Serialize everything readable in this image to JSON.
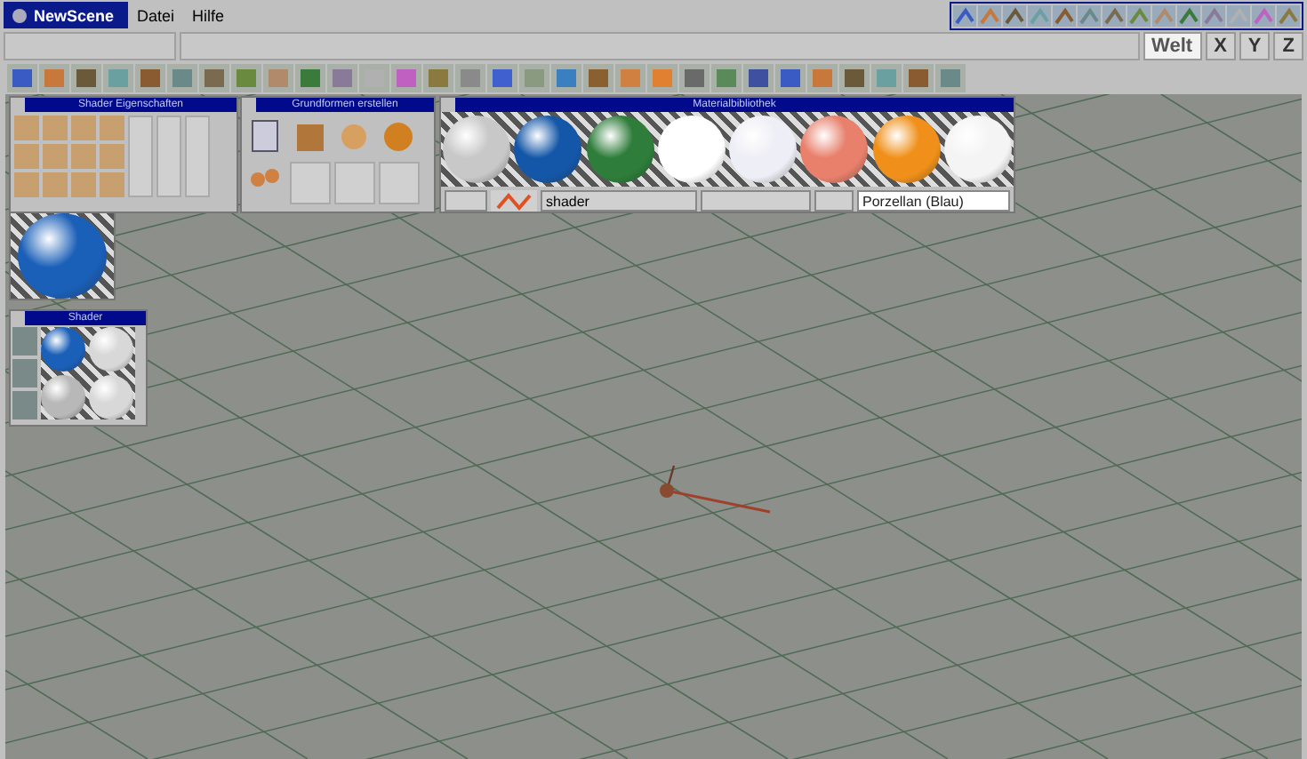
{
  "window": {
    "title": "NewScene"
  },
  "menu": [
    "Datei",
    "Hilfe"
  ],
  "coord_buttons": [
    {
      "label": "Welt",
      "selected": true
    },
    {
      "label": "X",
      "selected": false
    },
    {
      "label": "Y",
      "selected": false
    },
    {
      "label": "Z",
      "selected": false
    }
  ],
  "shader_properties": {
    "title": "Shader Eigenschaften"
  },
  "primitives": {
    "title": "Grundformen erstellen"
  },
  "preview": {
    "color": "#1a5fb8"
  },
  "library": {
    "title": "Materialbibliothek",
    "materials": [
      {
        "color": "#c8c8c8"
      },
      {
        "color": "#1457a8"
      },
      {
        "color": "#2e7d3a"
      },
      {
        "color": "#ffffff"
      },
      {
        "color": "#eeeef6"
      },
      {
        "color": "#e8806c"
      },
      {
        "color": "#f0901a"
      },
      {
        "color": "#f4f4f4"
      }
    ],
    "type_dropdown": "shader",
    "material_name": "Porzellan (Blau)"
  },
  "shader_panel": {
    "title": "Shader",
    "spheres": [
      {
        "color": "#1a5fb8"
      },
      {
        "color": "#d8d8d8"
      },
      {
        "color": "#b8b8b8"
      },
      {
        "color": "#d8d8d8"
      }
    ]
  }
}
